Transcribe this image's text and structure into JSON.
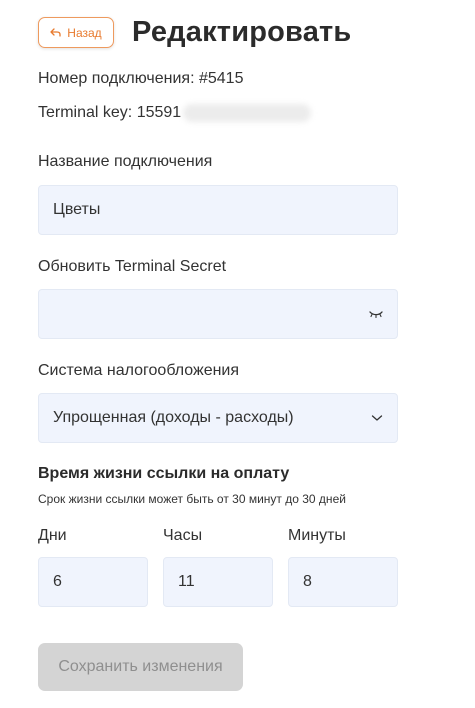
{
  "header": {
    "back_label": "Назад",
    "title": "Редактировать"
  },
  "info": {
    "connection_number": "Номер подключения: #5415",
    "terminal_key": "Terminal key: 15591"
  },
  "form": {
    "name": {
      "label": "Название подключения",
      "value": "Цветы"
    },
    "secret": {
      "label": "Обновить Terminal Secret",
      "value": ""
    },
    "tax": {
      "label": "Система налогообложения",
      "value": "Упрощенная (доходы - расходы)"
    }
  },
  "link_lifetime": {
    "title": "Время жизни ссылки на оплату",
    "hint": "Срок жизни ссылки может быть от 30 минут до 30 дней",
    "days": {
      "label": "Дни",
      "value": "6"
    },
    "hours": {
      "label": "Часы",
      "value": "11"
    },
    "minutes": {
      "label": "Минуты",
      "value": "8"
    }
  },
  "save_label": "Сохранить изменения",
  "colors": {
    "accent": "#e87a2e",
    "field_bg": "#f0f4fd",
    "disabled_button": "#d4d4d4"
  },
  "icons": [
    "back-arrow-icon",
    "eye-closed-icon",
    "chevron-down-icon"
  ]
}
